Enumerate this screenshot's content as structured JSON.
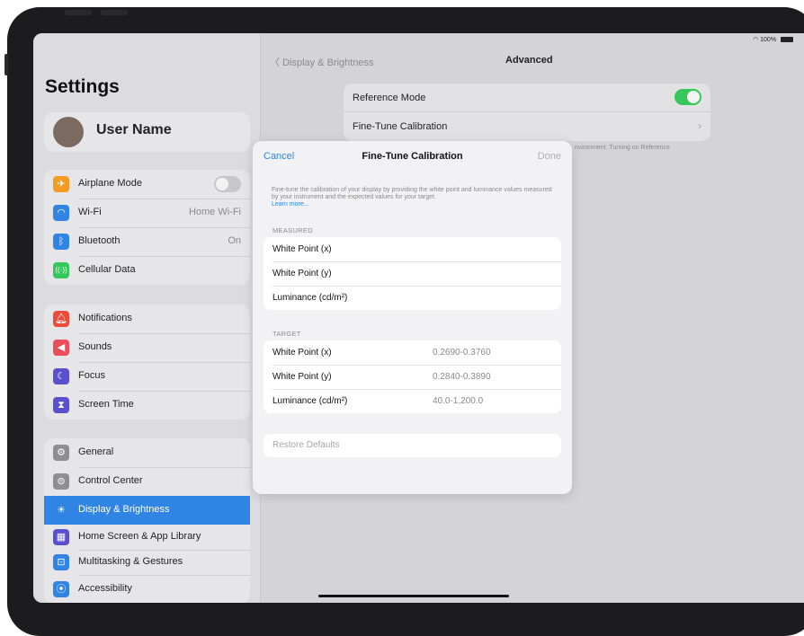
{
  "colors": {
    "accent": "#2f84e4",
    "toggle_on": "#34c759",
    "bezel": "#1c1c1e"
  },
  "status_bar": {
    "battery": "100%"
  },
  "sidebar": {
    "title": "Settings",
    "user_name": "User Name",
    "groups": [
      [
        {
          "label": "Airplane Mode",
          "icon": "airplane-icon",
          "toggle": "off"
        },
        {
          "label": "Wi-Fi",
          "icon": "wifi-icon",
          "value": "Home Wi-Fi"
        },
        {
          "label": "Bluetooth",
          "icon": "bluetooth-icon",
          "value": "On"
        },
        {
          "label": "Cellular Data",
          "icon": "cellular-icon"
        }
      ],
      [
        {
          "label": "Notifications",
          "icon": "bell-icon"
        },
        {
          "label": "Sounds",
          "icon": "speaker-icon"
        },
        {
          "label": "Focus",
          "icon": "moon-icon"
        },
        {
          "label": "Screen Time",
          "icon": "hourglass-icon"
        }
      ],
      [
        {
          "label": "General",
          "icon": "gear-icon"
        },
        {
          "label": "Control Center",
          "icon": "toggles-icon"
        },
        {
          "label": "Display & Brightness",
          "icon": "sun-icon",
          "selected": true
        },
        {
          "label": "Home Screen & App Library",
          "icon": "grid-icon"
        },
        {
          "label": "Multitasking & Gestures",
          "icon": "multitask-icon"
        },
        {
          "label": "Accessibility",
          "icon": "accessibility-icon"
        }
      ]
    ]
  },
  "detail": {
    "back_label": "Display & Brightness",
    "title": "Advanced",
    "reference_mode_label": "Reference Mode",
    "reference_mode": "on",
    "fine_tune_label": "Fine-Tune Calibration",
    "footer_note": "nvironment. Turning on Reference"
  },
  "modal": {
    "cancel": "Cancel",
    "title": "Fine-Tune Calibration",
    "done": "Done",
    "description": "Fine-tune the calibration of your display by providing the white point and luminance values measured by your instrument and the expected values for your target.",
    "learn_more": "Learn more...",
    "measured_header": "MEASURED",
    "measured": [
      {
        "label": "White Point (x)",
        "value": ""
      },
      {
        "label": "White Point (y)",
        "value": ""
      },
      {
        "label": "Luminance (cd/m²)",
        "value": ""
      }
    ],
    "target_header": "TARGET",
    "target": [
      {
        "label": "White Point (x)",
        "value": "0.2690-0.3760"
      },
      {
        "label": "White Point (y)",
        "value": "0.2840-0.3890"
      },
      {
        "label": "Luminance (cd/m²)",
        "value": "40.0-1,200.0"
      }
    ],
    "restore": "Restore Defaults"
  }
}
